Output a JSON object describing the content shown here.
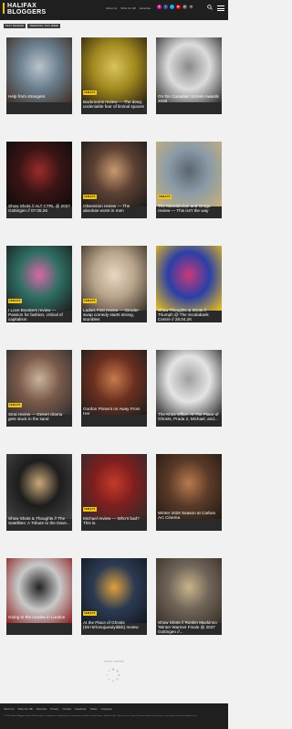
{
  "site": {
    "logo_line1": "HALIFAX",
    "logo_line2": "BLOGGERS"
  },
  "top_links": [
    "About Us",
    "Write for HB",
    "Advertise"
  ],
  "social": [
    {
      "icon": "instagram-icon",
      "color": "#d6249f",
      "glyph": "●"
    },
    {
      "icon": "facebook-icon",
      "color": "#3b5998",
      "glyph": "f"
    },
    {
      "icon": "twitter-icon",
      "color": "#1da1f2",
      "glyph": "t"
    },
    {
      "icon": "youtube-icon",
      "color": "#ff0000",
      "glyph": "▶"
    },
    {
      "icon": "email-icon",
      "color": "#555555",
      "glyph": "@"
    },
    {
      "icon": "threads-icon",
      "color": "#333333",
      "glyph": "@"
    }
  ],
  "filters": [
    "STAY BOOKED",
    "TRENDING THIS WEEK"
  ],
  "cards": [
    {
      "title": "Help from strangers",
      "tag": "",
      "short": true
    },
    {
      "title": "Backrooms review — The deep, undeniable fear of liminal spaces",
      "tag": "FILM & TV",
      "short": false
    },
    {
      "title": "On the Canadian Screen Awards 2026",
      "tag": "",
      "short": true
    },
    {
      "title": "Show Shots // ALT CTRL @ 2037 Gottingen // 07.05.26",
      "tag": "",
      "short": false
    },
    {
      "title": "Obsession review — The absolute worst in men",
      "tag": "FILM & TV",
      "short": false
    },
    {
      "title": "The Mandalorian and Grogu review — This isn't the way",
      "tag": "FILM & TV",
      "short": false
    },
    {
      "title": "I Love Boosters review — Passion for fashion, critical of capitalism",
      "tag": "FILM & TV",
      "short": false
    },
    {
      "title": "Ladies First review — Gender-swap comedy starts strong, stumbles",
      "tag": "FILM & TV",
      "short": false
    },
    {
      "title": "Show Thoughts & Shots // Triumph @ The Scotiabank Centre // 28.04.26",
      "tag": "",
      "short": false
    },
    {
      "title": "Strat review — Desert drama gets stuck in the sand",
      "tag": "FILM & TV",
      "short": false
    },
    {
      "title": "Gordon Pinsent on Away From Her",
      "tag": "",
      "short": true
    },
    {
      "title": "The Knox Office: At The Place of Ghosts, Prada 2, Michael, and...",
      "tag": "",
      "short": false
    },
    {
      "title": "Show Shots & Thoughts // The Satellites: A Tribute to the Dave...",
      "tag": "",
      "short": false
    },
    {
      "title": "Michael review — Who's bad? This is.",
      "tag": "FILM & TV",
      "short": false
    },
    {
      "title": "Winter 2026 Season at Carbon Arc Cinema",
      "tag": "",
      "short": true
    },
    {
      "title": "Going to the movies in London",
      "tag": "",
      "short": true
    },
    {
      "title": "At the Place of Ghosts (Sk+te'kmujuewiyikkik) review",
      "tag": "FILM & TV",
      "short": false
    },
    {
      "title": "Show Shots // Ronkin Mackinno 'Winter Warmer Finale @ 2037 Gottingen //...",
      "tag": "",
      "short": false
    }
  ],
  "load_more": "LOAD MORE",
  "footer": {
    "links": [
      "About Us",
      "Write For HB",
      "Advertise",
      "Privacy",
      "Contact",
      "Facebook",
      "Twitter",
      "Instagram"
    ],
    "copyright": "© 2026 Halifax Bloggers Media. Reflecting the standard on everything that's happening in Halifax. Social Events · Movies & film · Music & Live. Terms & Privacy. Submit a news tip or event listing to ask our editorial team."
  }
}
